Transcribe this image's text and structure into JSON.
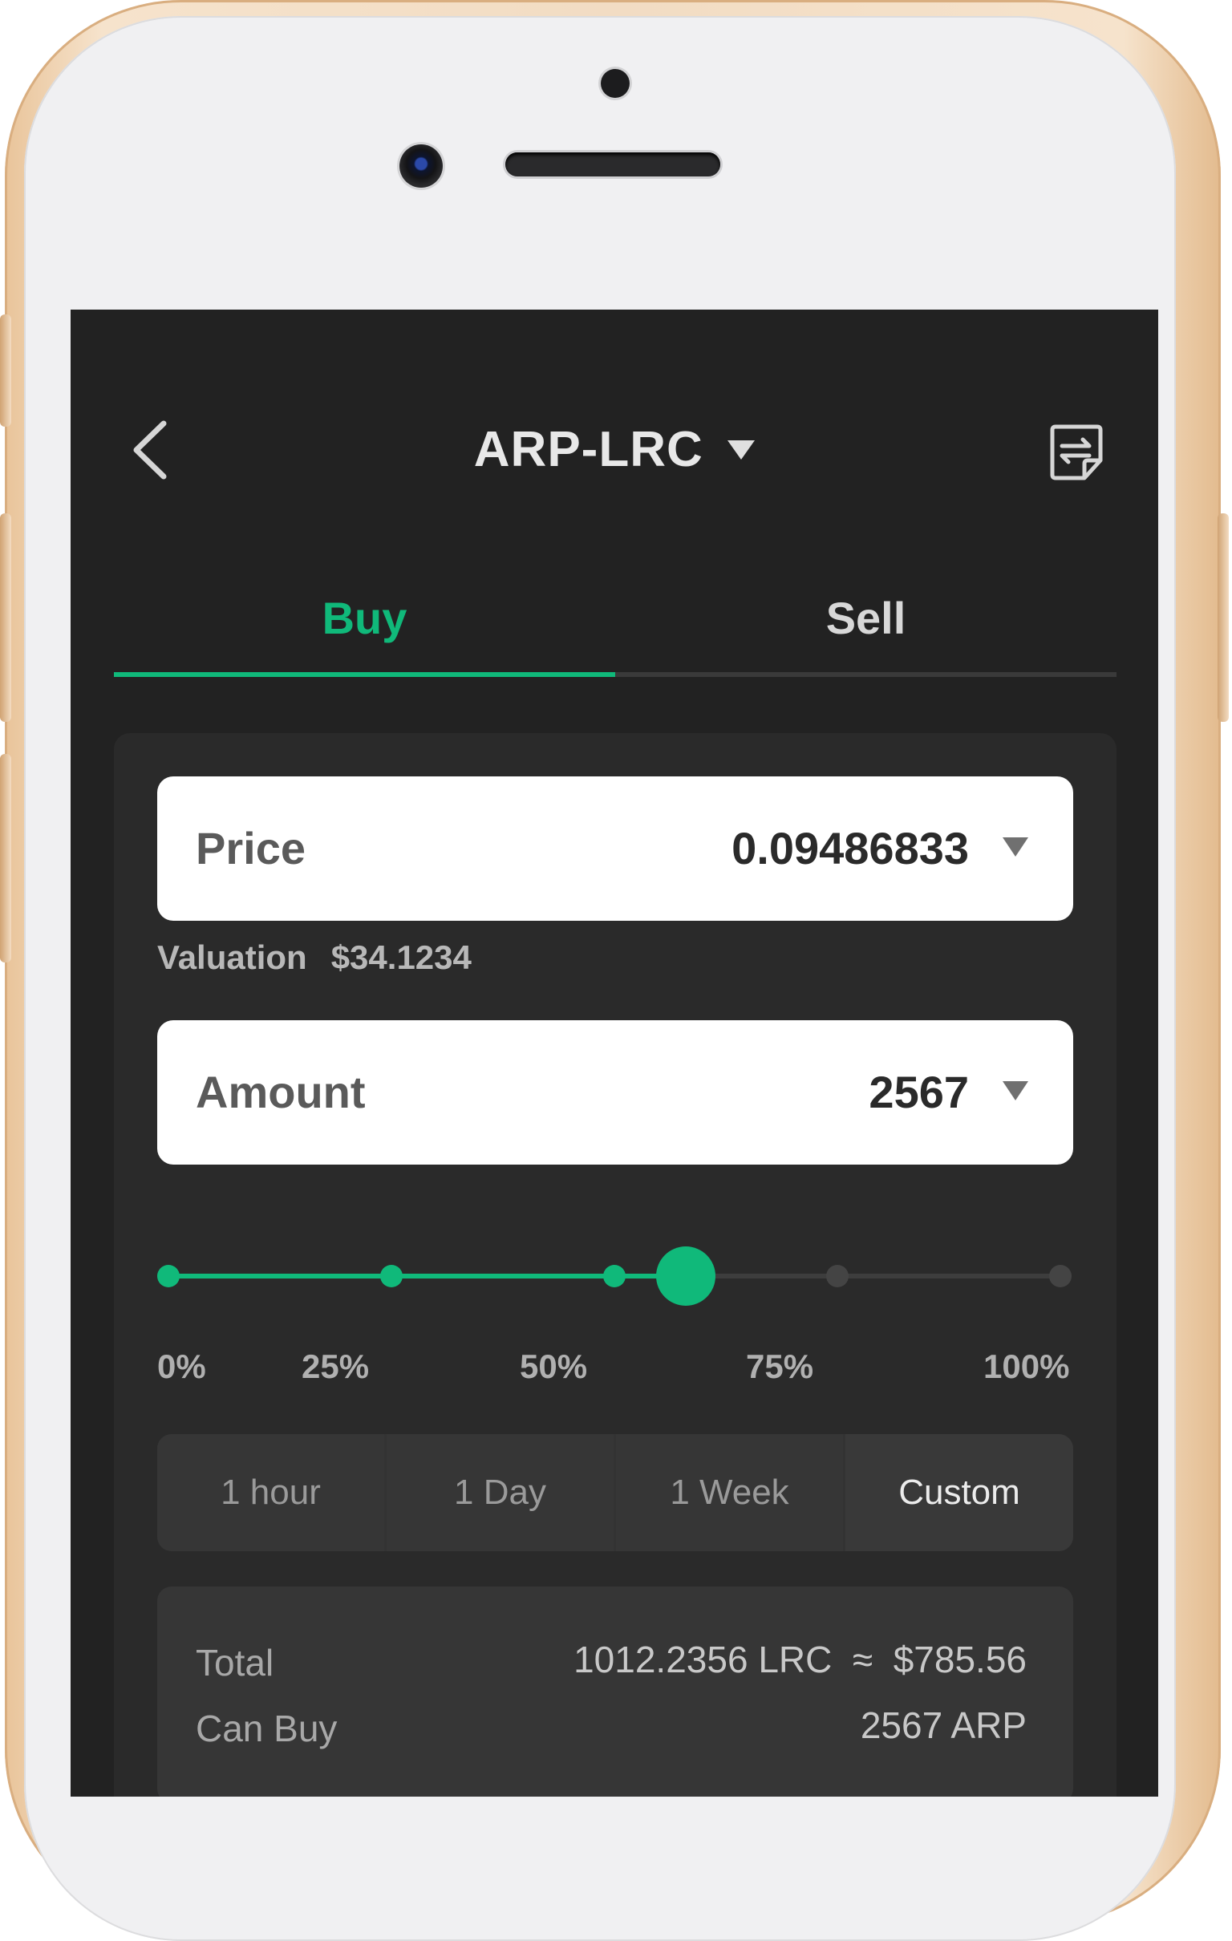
{
  "header": {
    "pair": "ARP-LRC"
  },
  "tabs": [
    {
      "label": "Buy",
      "active": true
    },
    {
      "label": "Sell",
      "active": false
    }
  ],
  "form": {
    "price": {
      "label": "Price",
      "value": "0.09486833"
    },
    "valuation": {
      "label": "Valuation",
      "value": "$34.1234"
    },
    "amount": {
      "label": "Amount",
      "value": "2567"
    }
  },
  "slider": {
    "value_percent": 58,
    "labels": [
      "0%",
      "25%",
      "50%",
      "75%",
      "100%"
    ]
  },
  "durations": [
    {
      "label": "1 hour",
      "active": false
    },
    {
      "label": "1 Day",
      "active": false
    },
    {
      "label": "1 Week",
      "active": false
    },
    {
      "label": "Custom",
      "active": true
    }
  ],
  "summary": {
    "total_label": "Total",
    "total_value": "1012.2356 LRC  ≈  $785.56",
    "can_buy_label": "Can Buy",
    "can_buy_value": "2567 ARP"
  },
  "icons": {
    "back": "chevron-left-icon",
    "pair_dropdown": "caret-down-icon",
    "swap": "swap-document-icon"
  },
  "colors": {
    "accent": "#10b97a",
    "screen_bg": "#222222",
    "panel_bg": "#2a2a2a",
    "frame": "#f2dcc3"
  }
}
